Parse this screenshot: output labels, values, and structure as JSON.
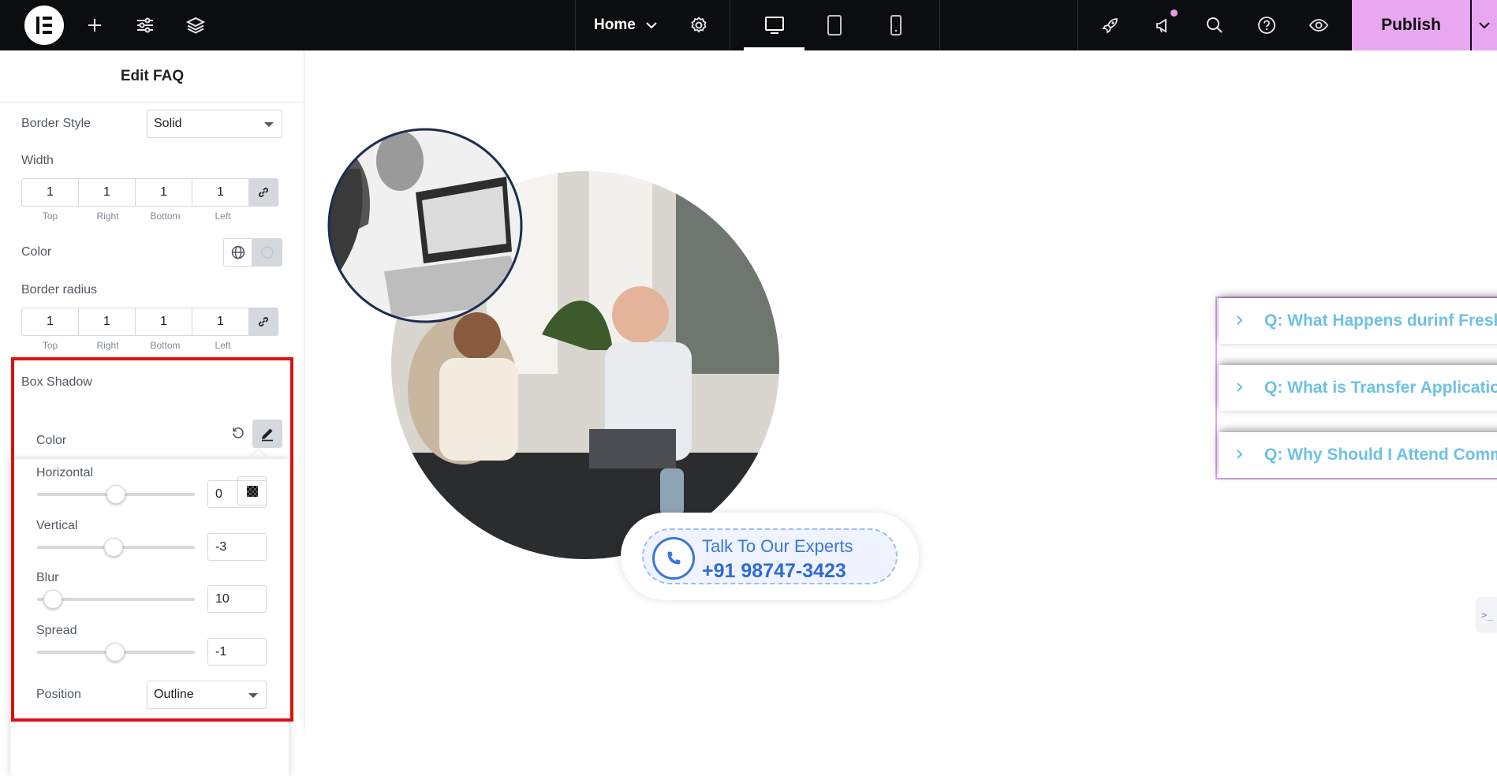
{
  "topbar": {
    "page_name": "Home",
    "publish_label": "Publish",
    "icons": [
      "elementor-logo-icon",
      "add-icon",
      "site-settings-icon",
      "structure-layers-icon",
      "chevron-down-icon",
      "page-settings-gear-icon",
      "desktop-icon",
      "tablet-icon",
      "mobile-icon",
      "rocket-icon",
      "notifications-megaphone-icon",
      "search-icon",
      "help-icon",
      "preview-eye-icon",
      "publish-options-chevron-icon"
    ]
  },
  "panel": {
    "title": "Edit FAQ",
    "border_style": {
      "label": "Border Style",
      "value": "Solid"
    },
    "width": {
      "label": "Width",
      "top": "1",
      "right": "1",
      "bottom": "1",
      "left": "1"
    },
    "dim_labels": {
      "top": "Top",
      "right": "Right",
      "bottom": "Bottom",
      "left": "Left"
    },
    "color_label": "Color",
    "border_radius": {
      "label": "Border radius",
      "top": "1",
      "right": "1",
      "bottom": "1",
      "left": "1"
    },
    "box_shadow": {
      "label": "Box Shadow",
      "color_label": "Color",
      "horizontal": {
        "label": "Horizontal",
        "value": "0",
        "fraction": 0.5
      },
      "vertical": {
        "label": "Vertical",
        "value": "-3",
        "fraction": 0.485
      },
      "blur": {
        "label": "Blur",
        "value": "10",
        "fraction": 0.1
      },
      "spread": {
        "label": "Spread",
        "value": "-1",
        "fraction": 0.495
      },
      "position": {
        "label": "Position",
        "value": "Outline"
      }
    }
  },
  "canvas": {
    "faq": [
      "Q: What Happens durinf Fresher's Week?",
      "Q: What is Transfer Application Process?",
      "Q: Why Should I Attend Community College?"
    ],
    "cta": {
      "title": "Talk To Our Experts",
      "phone": "+91 98747-3423"
    },
    "accent_color": "#6ec1e4"
  }
}
